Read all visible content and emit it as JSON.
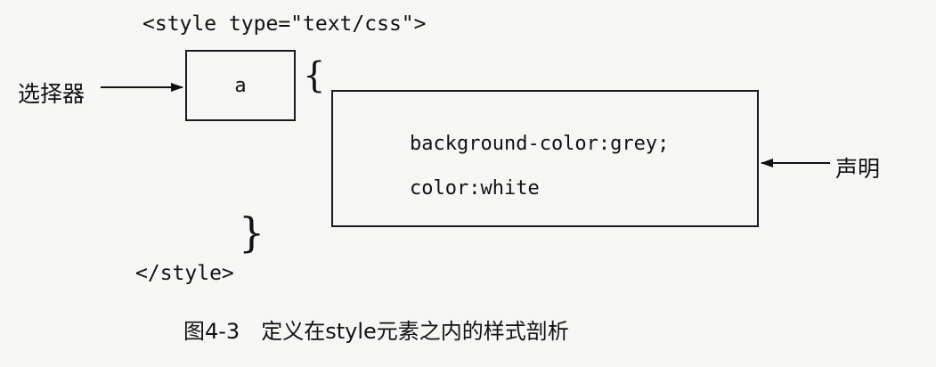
{
  "diagram": {
    "open_tag": "<style type=\"text/css\">",
    "close_tag": "</style>",
    "selector": {
      "label": "选择器",
      "value": "a"
    },
    "brace_open": "{",
    "brace_close": "}",
    "declaration": {
      "label": "声明",
      "lines": [
        "background-color:grey;",
        "color:white"
      ]
    },
    "caption": {
      "number": "图4-3",
      "text": "定义在style元素之内的样式剖析"
    }
  }
}
